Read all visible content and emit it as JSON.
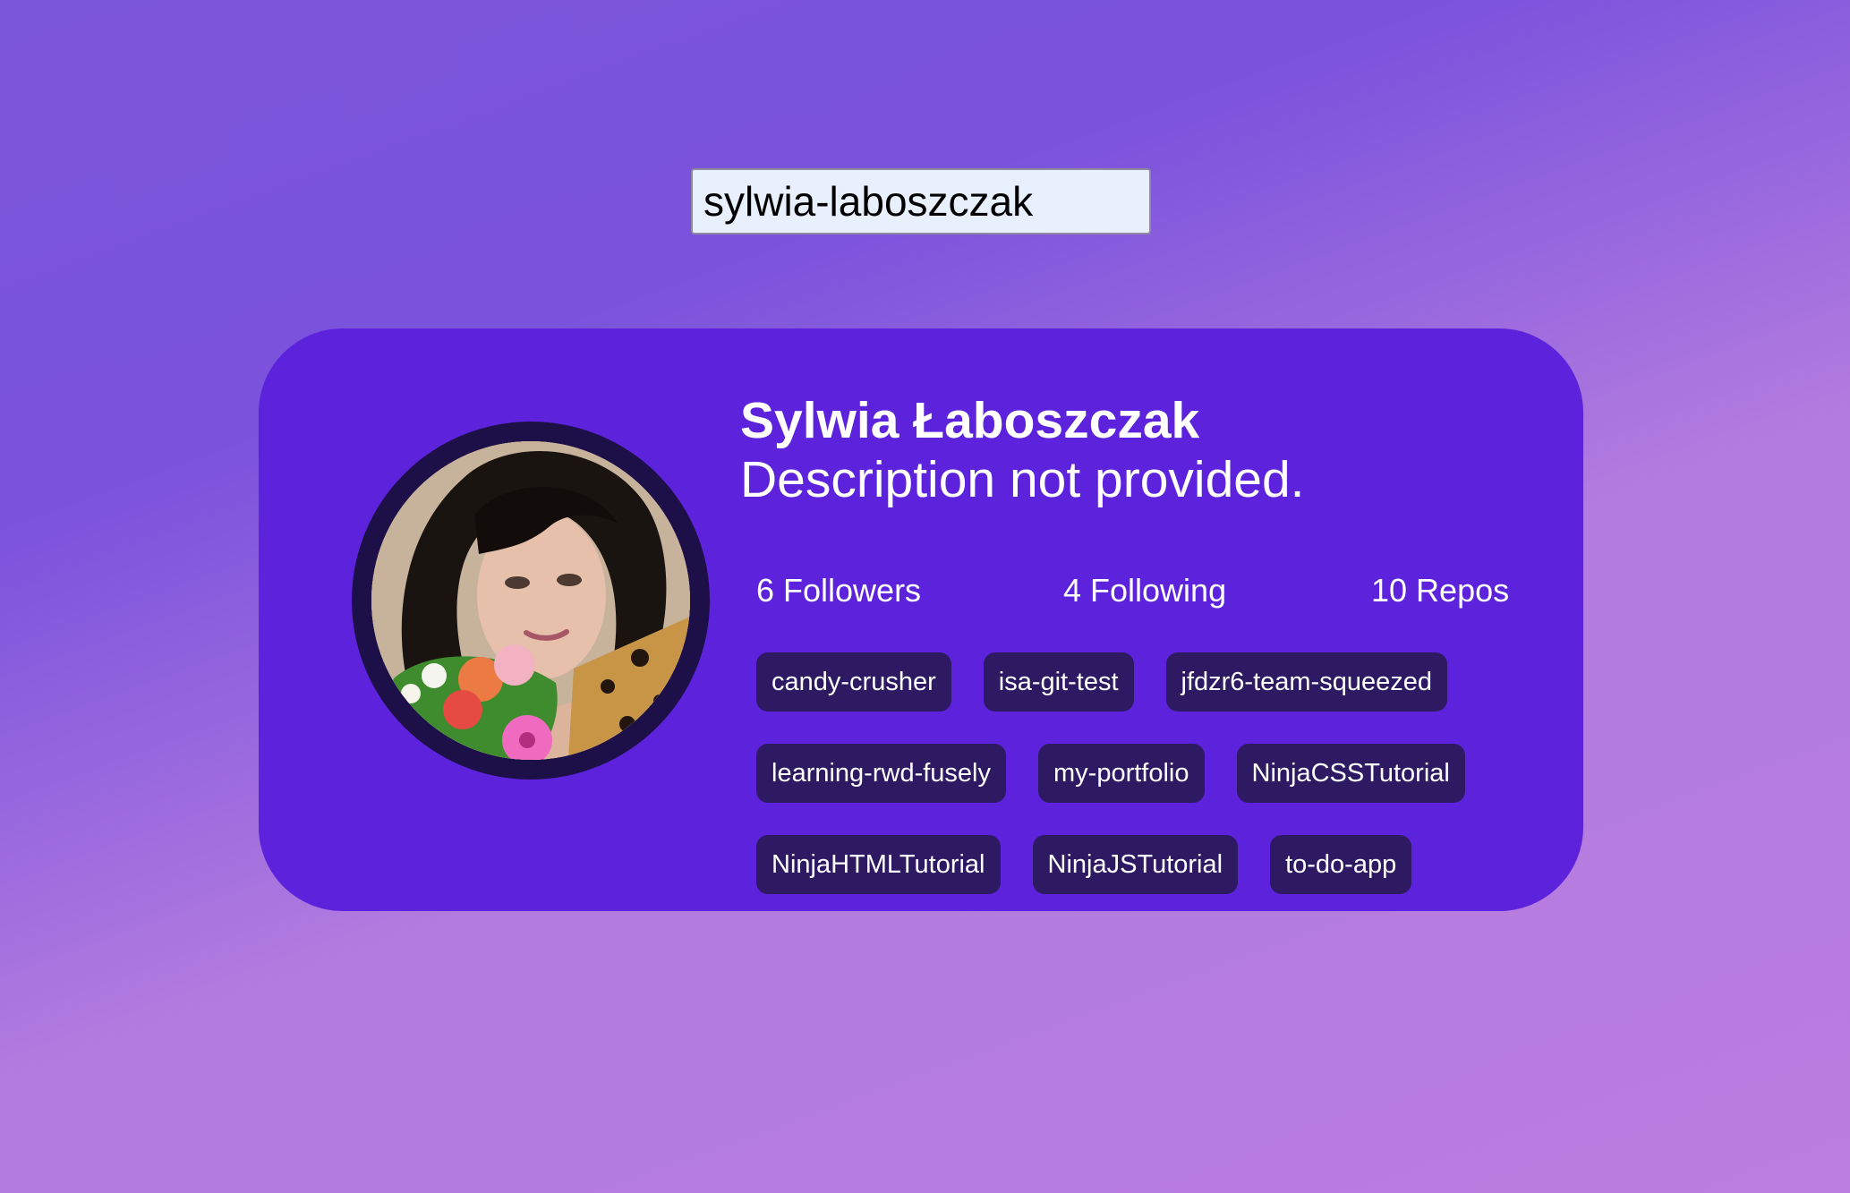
{
  "search": {
    "value": "sylwia-laboszczak",
    "placeholder": ""
  },
  "profile": {
    "name": "Sylwia Łaboszczak",
    "description": "Description not provided.",
    "stats": {
      "followers": "6 Followers",
      "following": "4 Following",
      "repos": "10 Repos"
    },
    "repos": [
      "candy-crusher",
      "isa-git-test",
      "jfdzr6-team-squeezed",
      "learning-rwd-fusely",
      "my-portfolio",
      "NinjaCSSTutorial",
      "NinjaHTMLTutorial",
      "NinjaJSTutorial",
      "to-do-app"
    ]
  },
  "colors": {
    "card": "#5d23dc",
    "chip": "#2e1a63",
    "avatar_ring": "#1d0f47",
    "input_background": "#e8effd"
  }
}
